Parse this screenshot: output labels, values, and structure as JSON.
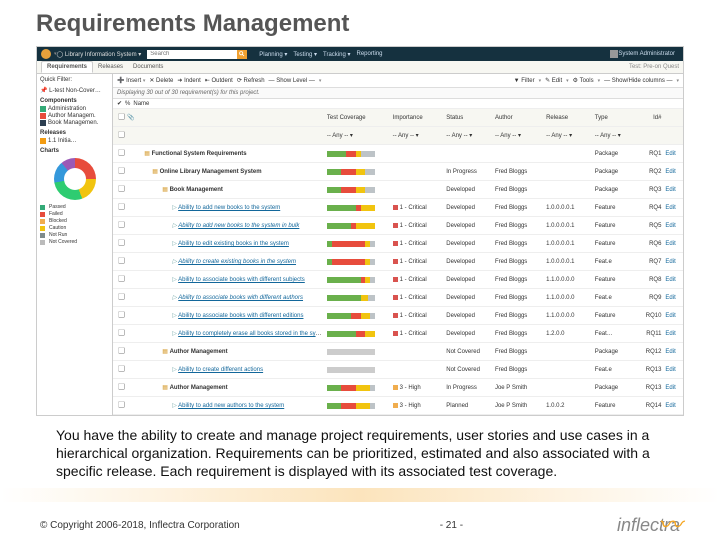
{
  "slide": {
    "title": "Requirements Management",
    "description": "You have the ability to create and manage project requirements, user stories and use cases in a hierarchical organization. Requirements can be prioritized, estimated and also associated with a specific release. Each requirement is displayed with its associated test coverage.",
    "copyright": "© Copyright 2006-2018, Inflectra Corporation",
    "page": "- 21 -",
    "brand": "inflectra"
  },
  "topbar": {
    "project": "Library Information System",
    "search_ph": "Search",
    "menu": [
      "Planning ▾",
      "Testing ▾",
      "Tracking ▾",
      "Reporting"
    ],
    "user": "System Administrator"
  },
  "tabs": {
    "items": [
      "Requirements",
      "Releases",
      "Documents"
    ],
    "right": "Test: Pre-on Quest"
  },
  "toolbar": {
    "insert": "Insert",
    "delete": "✕ Delete",
    "indent": "➜ Indent",
    "outdent": "⇤ Outdent",
    "refresh": "⟳ Refresh",
    "showlevel": "— Show Level —",
    "filter": "▼ Filter",
    "edit": "✎ Edit",
    "tools": "⚙ Tools",
    "columns": "— Show/Hide columns —"
  },
  "info": "Displaying 30 out of 30 requirement(s) for this project.",
  "hover": {
    "chk": "✔",
    "pct": "%",
    "name": "Name"
  },
  "sidebar": {
    "quick": "Quick Filter:",
    "pinned": "📌 L-test Non-Cover…",
    "components": "Components",
    "comp": [
      "Administration",
      "Author Managem.",
      "Book Managemen."
    ],
    "releases": "Releases",
    "rel": "1.1 Initia…",
    "charts": "Charts",
    "donut": [
      "2",
      "3",
      "16",
      "9"
    ],
    "legend": [
      {
        "c": "#3a7",
        "l": "Passed"
      },
      {
        "c": "#e74c3c",
        "l": "Failed"
      },
      {
        "c": "#f0ad4e",
        "l": "Blocked"
      },
      {
        "c": "#f1c40f",
        "l": "Caution"
      },
      {
        "c": "#7f8c8d",
        "l": "Not Run"
      },
      {
        "c": "#bbb",
        "l": "Not Covered"
      }
    ]
  },
  "cols": {
    "cov": "Test Coverage",
    "imp": "Importance",
    "stat": "Status",
    "auth": "Author",
    "rel": "Release",
    "type": "Type",
    "id": "Id#"
  },
  "filters": {
    "any": "-- Any --"
  },
  "rows": [
    {
      "ind": 0,
      "cls": "pkg",
      "name": "Functional System Requirements",
      "cov": [
        40,
        20,
        10,
        30
      ],
      "imp": "",
      "stat": "",
      "auth": "",
      "rel": "",
      "type": "Package",
      "id": "RQ1",
      "link": false
    },
    {
      "ind": 1,
      "cls": "pkg",
      "name": "Online Library Management System",
      "cov": [
        30,
        30,
        20,
        20
      ],
      "imp": "",
      "stat": "In Progress",
      "auth": "Fred Bloggs",
      "rel": "",
      "type": "Package",
      "id": "RQ2",
      "link": false
    },
    {
      "ind": 2,
      "cls": "pkg",
      "name": "Book Management",
      "cov": [
        30,
        30,
        20,
        20
      ],
      "imp": "",
      "stat": "Developed",
      "auth": "Fred Bloggs",
      "rel": "",
      "type": "Package",
      "id": "RQ3",
      "link": false
    },
    {
      "ind": 3,
      "cls": "req",
      "name": "Ability to add new books to the system",
      "cov": [
        60,
        10,
        30,
        0
      ],
      "imp": "1 - Critical",
      "dot": "d-crit",
      "stat": "Developed",
      "auth": "Fred Bloggs",
      "rel": "1.0.0.0.0.1",
      "type": "Feature",
      "id": "RQ4",
      "link": true
    },
    {
      "ind": 3,
      "cls": "req it",
      "name": "Ability to add new books to the system in bulk",
      "cov": [
        50,
        10,
        40,
        0
      ],
      "imp": "1 - Critical",
      "dot": "d-crit",
      "stat": "Developed",
      "auth": "Fred Bloggs",
      "rel": "1.0.0.0.0.1",
      "type": "Feature",
      "id": "RQ5",
      "link": true
    },
    {
      "ind": 3,
      "cls": "req",
      "name": "Ability to edit existing books in the system",
      "cov": [
        10,
        70,
        10,
        10
      ],
      "imp": "1 - Critical",
      "dot": "d-crit",
      "stat": "Developed",
      "auth": "Fred Bloggs",
      "rel": "1.0.0.0.0.1",
      "type": "Feature",
      "id": "RQ6",
      "link": true
    },
    {
      "ind": 3,
      "cls": "req it",
      "name": "Ability to create existing books in the system",
      "cov": [
        10,
        70,
        10,
        10
      ],
      "imp": "1 - Critical",
      "dot": "d-crit",
      "stat": "Developed",
      "auth": "Fred Bloggs",
      "rel": "1.0.0.0.0.1",
      "type": "Feat.e",
      "id": "RQ7",
      "link": true
    },
    {
      "ind": 3,
      "cls": "req",
      "name": "Ability to associate books with different subjects",
      "cov": [
        70,
        10,
        10,
        10
      ],
      "imp": "1 - Critical",
      "dot": "d-crit",
      "stat": "Developed",
      "auth": "Fred Bloggs",
      "rel": "1.1.0.0.0.0",
      "type": "Feature",
      "id": "RQ8",
      "link": true
    },
    {
      "ind": 3,
      "cls": "req it",
      "name": "Ability to associate books with different authors",
      "cov": [
        70,
        0,
        15,
        15
      ],
      "imp": "1 - Critical",
      "dot": "d-crit",
      "stat": "Developed",
      "auth": "Fred Bloggs",
      "rel": "1.1.0.0.0.0",
      "type": "Feat.e",
      "id": "RQ9",
      "link": true
    },
    {
      "ind": 3,
      "cls": "req",
      "name": "Ability to associate books with different editions",
      "cov": [
        50,
        20,
        20,
        10
      ],
      "imp": "1 - Critical",
      "dot": "d-crit",
      "stat": "Developed",
      "auth": "Fred Bloggs",
      "rel": "1.1.0.0.0.0",
      "type": "Feature",
      "id": "RQ10",
      "link": true
    },
    {
      "ind": 3,
      "cls": "req",
      "name": "Ability to completely erase all books stored in the system with one click",
      "cov": [
        60,
        20,
        20,
        0
      ],
      "imp": "1 - Critical",
      "dot": "d-crit",
      "stat": "Developed",
      "auth": "Fred Bloggs",
      "rel": "1.2.0.0",
      "type": "Feat…",
      "id": "RQ11",
      "link": true
    },
    {
      "ind": 2,
      "cls": "pkg",
      "name": "Author Management",
      "cov": [
        0,
        0,
        0,
        100
      ],
      "imp": "",
      "stat": "Not Covered",
      "auth": "Fred Bloggs",
      "rel": "",
      "type": "Package",
      "id": "RQ12",
      "link": false,
      "grey": true
    },
    {
      "ind": 3,
      "cls": "req",
      "name": "Ability to create different actions",
      "cov": [
        0,
        0,
        0,
        100
      ],
      "imp": "",
      "stat": "Not Covered",
      "auth": "Fred Bloggs",
      "rel": "",
      "type": "Feat.e",
      "id": "RQ13",
      "link": true,
      "grey": true
    },
    {
      "ind": 2,
      "cls": "pkg",
      "name": "Author Management",
      "cov": [
        30,
        30,
        30,
        10
      ],
      "imp": "3 - High",
      "dot": "d-high",
      "stat": "In Progress",
      "auth": "Joe P Smith",
      "rel": "",
      "type": "Package",
      "id": "RQ13",
      "link": false
    },
    {
      "ind": 3,
      "cls": "req",
      "name": "Ability to add new authors to the system",
      "cov": [
        30,
        30,
        30,
        10
      ],
      "imp": "3 - High",
      "dot": "d-high",
      "stat": "Planned",
      "auth": "Joe P Smith",
      "rel": "1.0.0.2",
      "type": "Feature",
      "id": "RQ14",
      "link": true
    }
  ]
}
